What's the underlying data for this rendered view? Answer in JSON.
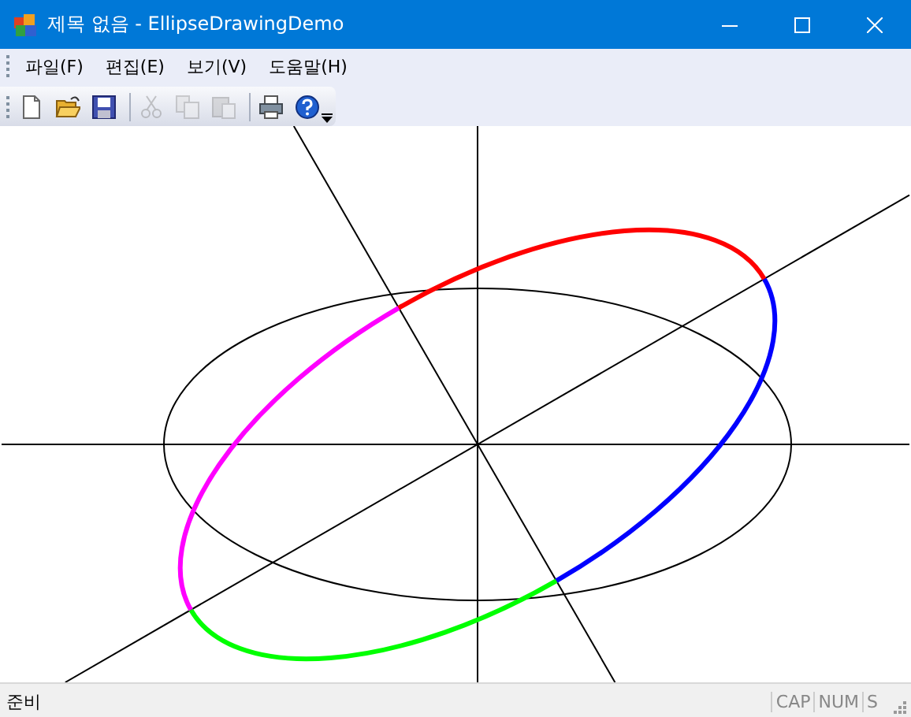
{
  "window": {
    "title": "제목 없음 - EllipseDrawingDemo"
  },
  "menu": [
    "파일(F)",
    "편집(E)",
    "보기(V)",
    "도움말(H)"
  ],
  "toolbar": [
    {
      "kind": "new",
      "disabled": false
    },
    {
      "kind": "open",
      "disabled": false
    },
    {
      "kind": "save",
      "disabled": false
    },
    {
      "kind": "separator"
    },
    {
      "kind": "cut",
      "disabled": true
    },
    {
      "kind": "copy",
      "disabled": true
    },
    {
      "kind": "paste",
      "disabled": true
    },
    {
      "kind": "separator"
    },
    {
      "kind": "print",
      "disabled": false
    },
    {
      "kind": "help",
      "disabled": false
    }
  ],
  "arcs": [
    {
      "color": "#0000ff"
    },
    {
      "color": "#00ff00"
    },
    {
      "color": "#ff00ff"
    },
    {
      "color": "#ff0000"
    }
  ],
  "status_bar": {
    "text": "준비",
    "panes": [
      "CAP",
      "NUM",
      "S"
    ]
  }
}
